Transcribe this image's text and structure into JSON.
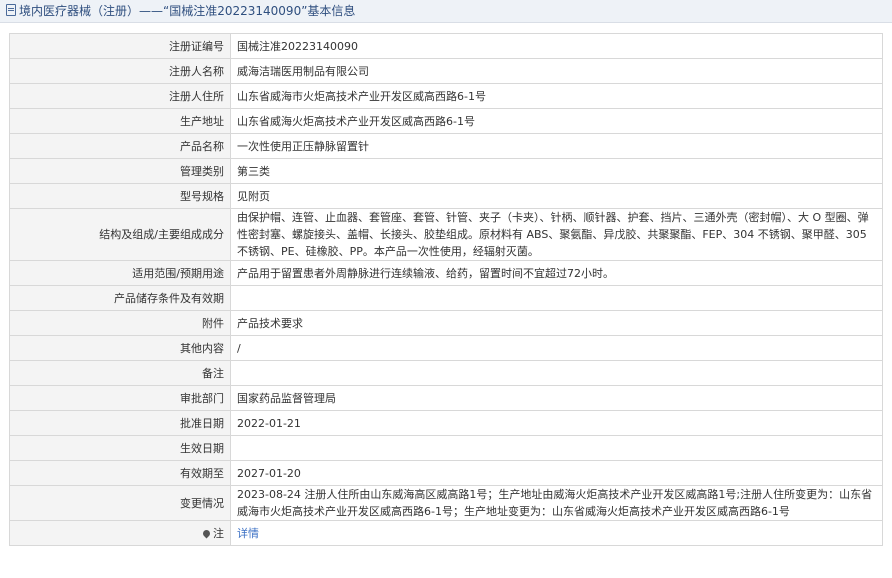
{
  "header": {
    "title": "境内医疗器械（注册）——“国械注准20223140090”基本信息"
  },
  "rows": [
    {
      "label": "注册证编号",
      "value": "国械注准20223140090"
    },
    {
      "label": "注册人名称",
      "value": "威海洁瑞医用制品有限公司"
    },
    {
      "label": "注册人住所",
      "value": "山东省威海市火炬高技术产业开发区威高西路6-1号"
    },
    {
      "label": "生产地址",
      "value": "山东省威海火炬高技术产业开发区威高西路6-1号"
    },
    {
      "label": "产品名称",
      "value": "一次性使用正压静脉留置针"
    },
    {
      "label": "管理类别",
      "value": "第三类"
    },
    {
      "label": "型号规格",
      "value": "见附页"
    },
    {
      "label": "结构及组成/主要组成成分",
      "value": "由保护帽、连管、止血器、套管座、套管、针管、夹子（卡夹）、针柄、顺针器、护套、挡片、三通外壳（密封帽）、大 O 型圈、弹性密封塞、螺旋接头、盖帽、长接头、胶垫组成。原材料有 ABS、聚氨酯、异戊胶、共聚聚酯、FEP、304 不锈钢、聚甲醛、305 不锈钢、PE、硅橡胶、PP。本产品一次性使用，经辐射灭菌。"
    },
    {
      "label": "适用范围/预期用途",
      "value": "产品用于留置患者外周静脉进行连续输液、给药，留置时间不宜超过72小时。"
    },
    {
      "label": "产品储存条件及有效期",
      "value": ""
    },
    {
      "label": "附件",
      "value": "产品技术要求"
    },
    {
      "label": "其他内容",
      "value": "/"
    },
    {
      "label": "备注",
      "value": ""
    },
    {
      "label": "审批部门",
      "value": "国家药品监督管理局"
    },
    {
      "label": "批准日期",
      "value": "2022-01-21"
    },
    {
      "label": "生效日期",
      "value": ""
    },
    {
      "label": "有效期至",
      "value": "2027-01-20"
    },
    {
      "label": "变更情况",
      "value": "2023-08-24 注册人住所由山东威海高区威高路1号；生产地址由威海火炬高技术产业开发区威高路1号;注册人住所变更为：山东省威海市火炬高技术产业开发区威高西路6-1号；生产地址变更为：山东省威海火炬高技术产业开发区威高西路6-1号"
    }
  ],
  "note": {
    "label": "注",
    "link": "详情"
  }
}
